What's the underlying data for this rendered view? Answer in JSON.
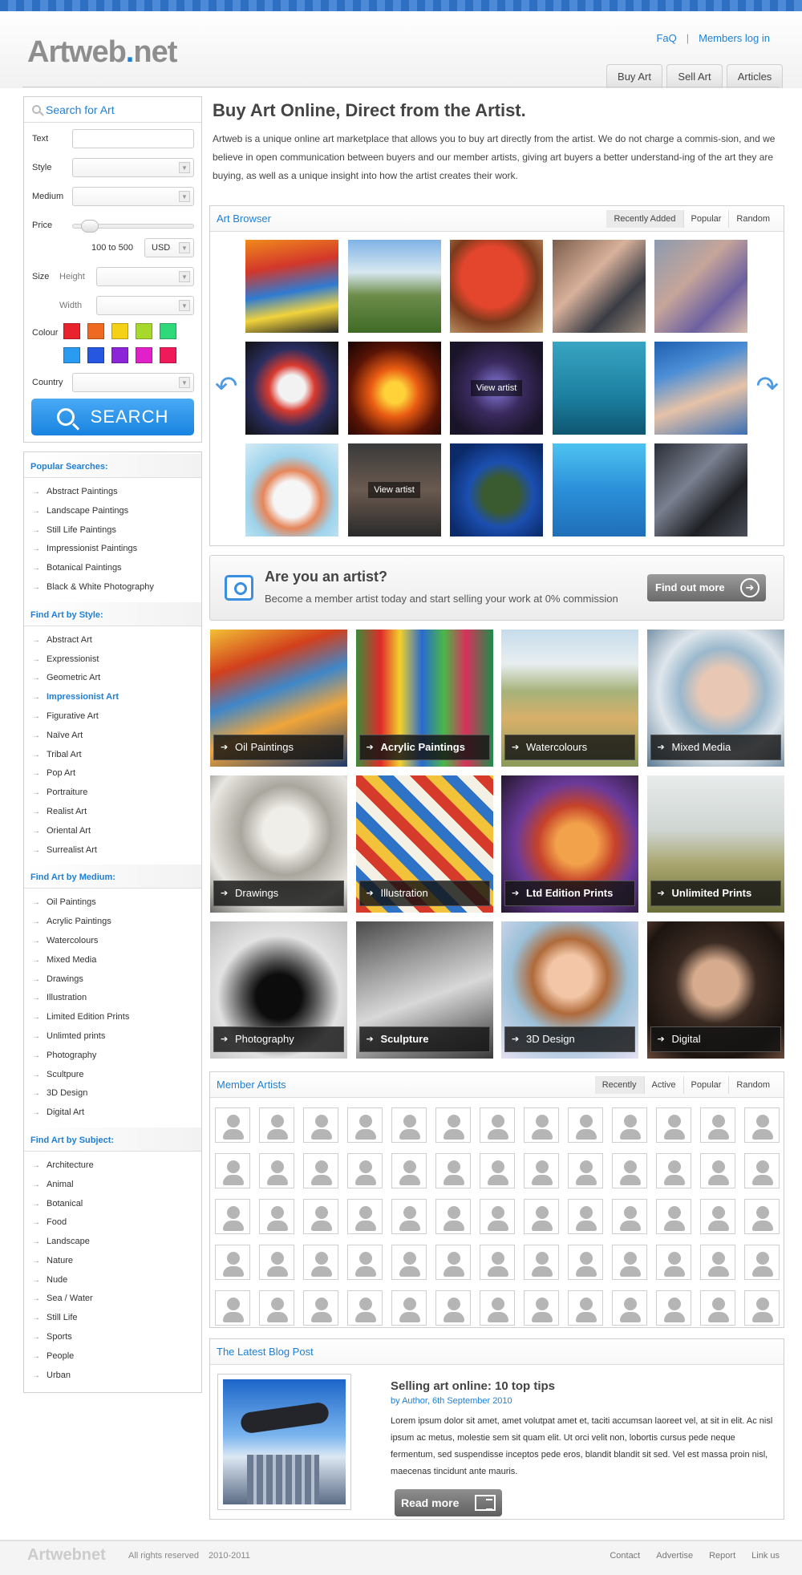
{
  "header": {
    "logo_main": "Artweb",
    "logo_dot": ".",
    "logo_tail": "net",
    "links": [
      "FaQ",
      "Members log in"
    ],
    "tabs": [
      "Buy Art",
      "Sell Art",
      "Articles"
    ]
  },
  "search": {
    "title": "Search for Art",
    "text_label": "Text",
    "style_label": "Style",
    "medium_label": "Medium",
    "price_label": "Price",
    "price_range": "100 to 500",
    "currency": "USD",
    "size_label": "Size",
    "height_label": "Height",
    "width_label": "Width",
    "colour_label": "Colour",
    "colours": [
      "#e8232d",
      "#ee6a22",
      "#f4d016",
      "#a6d92c",
      "#2fd97a",
      "#2a9bf0",
      "#2557e0",
      "#8c24d8",
      "#e020c8",
      "#ee1a5a"
    ],
    "country_label": "Country",
    "button": "SEARCH"
  },
  "categories": [
    {
      "title": "Popular Searches:",
      "items": [
        "Abstract Paintings",
        "Landscape Paintings",
        "Still Life Paintings",
        "Impressionist Paintings",
        "Botanical Paintings",
        "Black & White Photography"
      ]
    },
    {
      "title": "Find Art by Style:",
      "items": [
        "Abstract Art",
        "Expressionist",
        "Geometric Art",
        "Impressionist Art",
        "Figurative Art",
        "Naïve Art",
        "Tribal Art",
        "Pop Art",
        "Portraiture",
        "Realist Art",
        "Oriental Art",
        "Surrealist Art"
      ],
      "active": "Impressionist Art"
    },
    {
      "title": "Find Art by Medium:",
      "items": [
        "Oil Paintings",
        "Acrylic Paintings",
        "Watercolours",
        "Mixed Media",
        "Drawings",
        "Illustration",
        "Limited Edition Prints",
        "Unlimted prints",
        "Photography",
        "Scultpure",
        "3D Design",
        "Digital Art"
      ]
    },
    {
      "title": "Find Art by Subject:",
      "items": [
        "Architecture",
        "Animal",
        "Botanical",
        "Food",
        "Landscape",
        "Nature",
        "Nude",
        "Sea / Water",
        "Still Life",
        "Sports",
        "People",
        "Urban"
      ]
    }
  ],
  "main": {
    "title": "Buy Art Online, Direct from the Artist.",
    "intro": "Artweb is a unique online art marketplace that allows you to buy art directly from the artist. We do not charge a  commis-sion, and we believe in open communication between buyers and our member artists, giving art buyers a better understand-ing of the art they are buying, as well as a unique insight into how the artist creates their work."
  },
  "browser": {
    "title": "Art Browser",
    "tabs": [
      "Recently Added",
      "Popular",
      "Random"
    ],
    "selected_tab": "Recently Added",
    "view_artist": "View artist",
    "thumb_colors": [
      "linear-gradient(170deg,#f08a1c,#d3372a 30%,#2f7bd1 55%,#f1d33c 75%,#222)",
      "linear-gradient(#7fb2e6 0%,#d8e8f0 35%,#6c8c4a 60%,#3f6b26 100%)",
      "radial-gradient(circle at 45% 40%,#e4462d 0 40%,#7a3a1c 60%,#c9a372)",
      "linear-gradient(135deg,#7a5d4b,#d9b19b 40%,#3a3c44 70%,#9a8a7c)",
      "linear-gradient(135deg,#8c9bb0,#c6a59a 40%,#6c5fa0 70%,#d9bca8)",
      "radial-gradient(circle,#f2f2f2 0 20%,#d93a2e 35%,#2a2e60 60%,#111)",
      "radial-gradient(circle at 50% 55%,#ffd23a 0 15%,#e95b12 35%,#5a1406 65%,#150403)",
      "radial-gradient(circle,#6a5cae 0 15%,#3a2a5e 40%,#1a1428 80%)",
      "linear-gradient(#39a4c3,#1b7fa0 60%,#0e5670)",
      "linear-gradient(160deg,#1e5fb0 0%,#4c8ed6 30%,#e6c2a8 60%,#3b6fb3 100%)",
      "radial-gradient(circle at 50% 60%,#f6f6f6 0 25%,#e6865a 40%,#9ed3ec 60%,#d4ecf6)",
      "linear-gradient(#3a3a3a,#6a5a50 50%,#2a2a2a)",
      "radial-gradient(circle at 55% 55%,#3a5a30 0 25%,#1b4fb0 45%,#0b2a6a 80%)",
      "linear-gradient(#4dc3f0,#2b8fd9 50%,#1f6fb8)",
      "linear-gradient(135deg,#2a2e36,#7a8090 40%,#1e2024 70%,#4a4e58)"
    ],
    "view_overlays": [
      7,
      11
    ]
  },
  "artist_promo": {
    "title": "Are you an artist?",
    "subtitle": "Become a member artist today and start selling your work at 0% commission",
    "button": "Find out more"
  },
  "tiles": [
    {
      "label": "Oil Paintings",
      "bold": false,
      "bg": "linear-gradient(160deg,#f2c035 0%,#d2401c 25%,#3f87c9 45%,#f0a53a 65%,#1e3a6c 100%)"
    },
    {
      "label": "Acrylic Paintings",
      "bold": true,
      "bg": "linear-gradient(90deg,#3e8a3a 0%,#e02a2a 18%,#f2d22c 32%,#2a6ad0 48%,#49b848 64%,#d8315a 80%,#1e8c4a 100%)"
    },
    {
      "label": "Watercolours",
      "bold": false,
      "bg": "linear-gradient(#c6dcec 0%,#e8eef0 25%,#a6b27a 45%,#d8b06a 65%,#8a9a5a 100%)"
    },
    {
      "label": "Mixed Media",
      "bold": false,
      "bg": "radial-gradient(circle at 55% 45%,#e8c8b4 0 22%,#9ab8cc 40%,#dfe6ec 60%,#5d7c94 100%)"
    },
    {
      "label": "Drawings",
      "bold": false,
      "bg": "radial-gradient(circle at 55% 40%,#f0eee8 0 20%,#a9a69e 40%,#e8e6e0 70%,#6e6c68 100%)"
    },
    {
      "label": "Illustration",
      "bold": false,
      "bg": "repeating-linear-gradient(45deg,#d63a2a 0 14px,#f2c23a 14px 28px,#2f73c6 28px 42px,#f4f0e4 42px 56px)"
    },
    {
      "label": "Ltd Edition Prints",
      "bold": true,
      "bg": "radial-gradient(circle at 55% 50%,#f2a24a 0 20%,#c6422a 38%,#6a3a9a 60%,#24172e 100%)"
    },
    {
      "label": "Unlimited Prints",
      "bold": true,
      "bg": "linear-gradient(#e8ecec 0%,#cfd6d2 40%,#a9a56e 65%,#6b6f3a 100%)"
    },
    {
      "label": "Photography",
      "bold": false,
      "bg": "radial-gradient(circle at 50% 55%,#0c0c0c 0 22%,#505050 35%,#e2e2e2 60%,#bdbdbd 100%)"
    },
    {
      "label": "Sculpture",
      "bold": true,
      "bg": "linear-gradient(160deg,#4a4a4a 0%,#9a9a9a 30%,#d8d8d8 55%,#7a7a7a 80%,#3a3a3a 100%)"
    },
    {
      "label": "3D Design",
      "bold": false,
      "bg": "radial-gradient(circle at 50% 40%,#f2c6a6 0 20%,#b06a3a 35%,#9ac0d8 55%,#e6e0f2 100%)"
    },
    {
      "label": "Digital",
      "bold": false,
      "bg": "radial-gradient(circle at 50% 45%,#d7ac8e 0 22%,#3a2a22 40%,#1c1410 75%,#6a4a3a 100%)"
    }
  ],
  "members": {
    "title": "Member Artists",
    "tabs": [
      "Recently",
      "Active",
      "Popular",
      "Random"
    ],
    "selected_tab": "Recently",
    "rows": 5,
    "cols": 13
  },
  "blog": {
    "section_title": "The Latest Blog Post",
    "post_title": "Selling art online: 10 top tips",
    "byline": "by Author, 6th September 2010",
    "excerpt": "Lorem ipsum dolor sit amet, amet volutpat amet et, taciti accumsan laoreet vel, at sit in elit. Ac nisl ipsum ac metus, molestie sem sit quam elit. Ut orci velit non, lobortis cursus pede neque fermentum, sed suspendisse inceptos pede eros, blandit blandit sit sed. Vel est massa proin nisl, maecenas tincidunt ante mauris.",
    "button": "Read more"
  },
  "footer": {
    "logo": "Artwebnet",
    "rights": "All rights reserved",
    "years": "2010-2011",
    "links": [
      "Contact",
      "Advertise",
      "Report",
      "Link us"
    ]
  }
}
